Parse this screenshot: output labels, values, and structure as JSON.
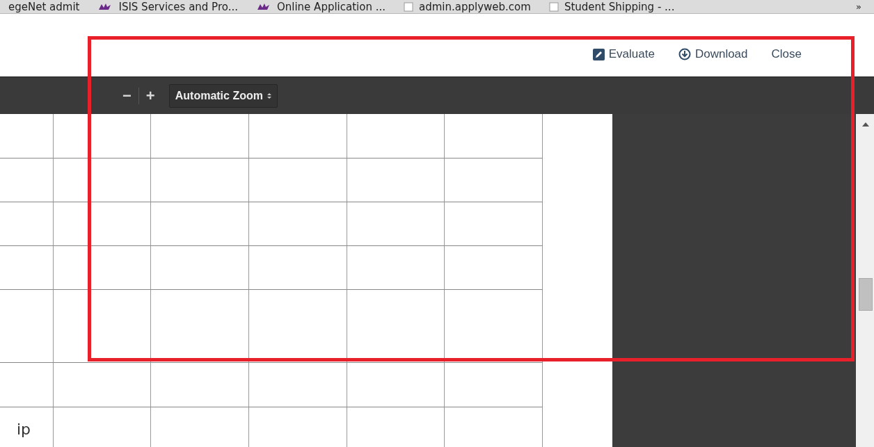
{
  "bookmarks": [
    {
      "label": "egeNet admit",
      "kind": "plain"
    },
    {
      "label": "ISIS Services and Pro...",
      "kind": "logo"
    },
    {
      "label": "Online Application ...",
      "kind": "logo"
    },
    {
      "label": "admin.applyweb.com",
      "kind": "page"
    },
    {
      "label": "Student Shipping - ...",
      "kind": "page"
    }
  ],
  "bookmarks_more": "»",
  "header_actions": [
    {
      "label": "Evaluate",
      "kind": "edit"
    },
    {
      "label": "Download",
      "kind": "download"
    },
    {
      "label": "Close",
      "kind": "plain"
    }
  ],
  "toolbar": {
    "zoom_out": "−",
    "zoom_in": "+",
    "zoom_select": "Automatic Zoom"
  },
  "document": {
    "page_text": "ip"
  }
}
